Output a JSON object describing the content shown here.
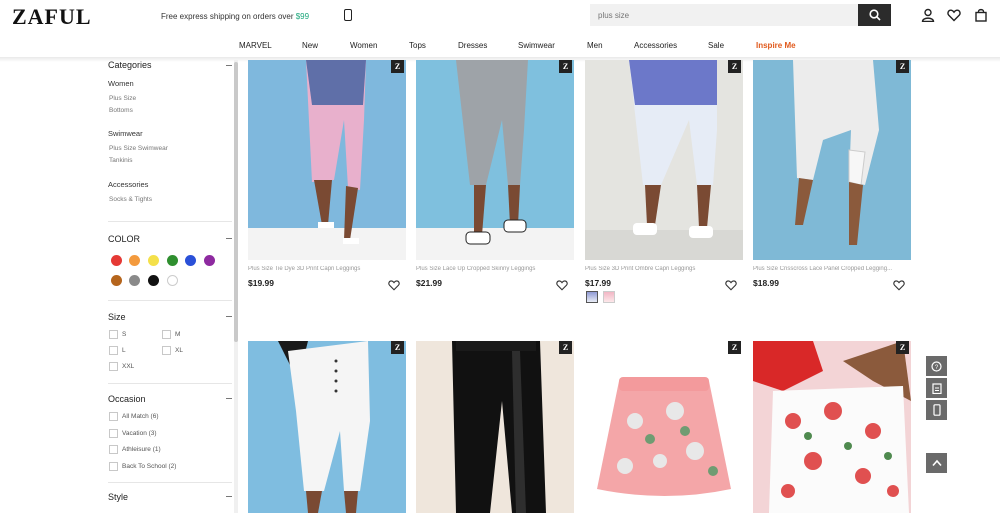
{
  "header": {
    "logo": "ZAFUL",
    "shipping_text": "Free express shipping on orders over ",
    "shipping_amount": "$99",
    "search_placeholder": "plus size"
  },
  "nav": [
    "MARVEL",
    "New",
    "Women",
    "Tops",
    "Dresses",
    "Swimwear",
    "Men",
    "Accessories",
    "Sale",
    "Inspire Me"
  ],
  "sidebar": {
    "categories_title": "Categories",
    "groups": [
      {
        "heading": "Women",
        "items": [
          "Plus Size",
          "Bottoms"
        ]
      },
      {
        "heading": "Swimwear",
        "items": [
          "Plus Size Swimwear",
          "Tankinis"
        ]
      },
      {
        "heading": "Accessories",
        "items": [
          "Socks & Tights"
        ]
      }
    ],
    "color_title": "COLOR",
    "colors": [
      "#e53935",
      "#f39a3d",
      "#f4e04a",
      "#2f8f2f",
      "#2a50d8",
      "#8e2aa0",
      "#b5651d",
      "#8a8a8a",
      "#111111",
      "#ffffff"
    ],
    "size_title": "Size",
    "sizes": [
      "S",
      "M",
      "L",
      "XL",
      "XXL"
    ],
    "occasion_title": "Occasion",
    "occasions": [
      "All Match (6)",
      "Vacation (3)",
      "Athleisure (1)",
      "Back To School (2)"
    ],
    "style_title": "Style"
  },
  "products": [
    {
      "name": "Plus Size Tie Dye 3D Print Capri Leggings",
      "price": "$19.99"
    },
    {
      "name": "Plus Size Lace Up Cropped Skinny Leggings",
      "price": "$21.99"
    },
    {
      "name": "Plus Size 3D Print Ombre Capri Leggings",
      "price": "$17.99"
    },
    {
      "name": "Plus Size Crisscross Lace Panel Cropped Legging...",
      "price": "$18.99"
    }
  ]
}
